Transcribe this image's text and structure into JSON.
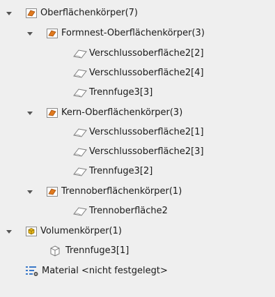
{
  "tree": {
    "nodes": [
      {
        "label": "Oberflächenkörper(7)",
        "icon": "surface-folder-icon",
        "expanded": true
      },
      {
        "label": "Formnest-Oberflächenkörper(3)",
        "icon": "surface-folder-icon",
        "expanded": true
      },
      {
        "label": "Verschlussoberfläche2[2]",
        "icon": "surface-icon"
      },
      {
        "label": "Verschlussoberfläche2[4]",
        "icon": "surface-icon"
      },
      {
        "label": "Trennfuge3[3]",
        "icon": "surface-icon"
      },
      {
        "label": "Kern-Oberflächenkörper(3)",
        "icon": "surface-folder-icon",
        "expanded": true
      },
      {
        "label": "Verschlussoberfläche2[1]",
        "icon": "surface-icon"
      },
      {
        "label": "Verschlussoberfläche2[3]",
        "icon": "surface-icon"
      },
      {
        "label": "Trennfuge3[2]",
        "icon": "surface-icon"
      },
      {
        "label": "Trennoberflächenkörper(1)",
        "icon": "surface-folder-icon",
        "expanded": true
      },
      {
        "label": "Trennoberfläche2",
        "icon": "surface-icon"
      },
      {
        "label": "Volumenkörper(1)",
        "icon": "solid-folder-icon",
        "expanded": true
      },
      {
        "label": "Trennfuge3[1]",
        "icon": "solid-body-icon"
      },
      {
        "label": "Material <nicht festgelegt>",
        "icon": "material-icon"
      }
    ]
  },
  "colors": {
    "background": "#efefef",
    "folder_orange": "#e07a1f",
    "folder_outline": "#8a8a8a",
    "solid_yellow": "#e8b81c",
    "material_blue": "#3a78c8"
  }
}
